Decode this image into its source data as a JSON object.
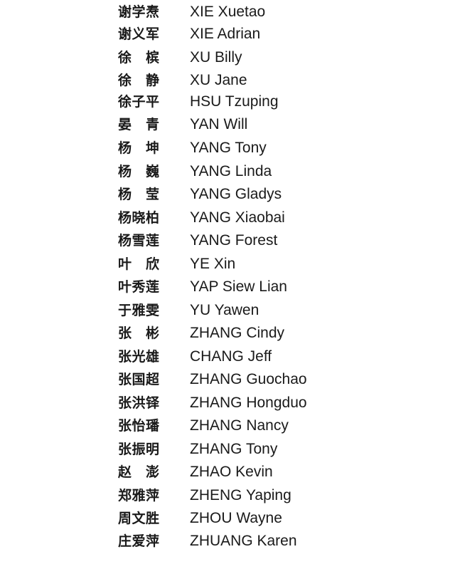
{
  "names": [
    {
      "chinese": "谢学焘",
      "english": "XIE Xuetao"
    },
    {
      "chinese": "谢义军",
      "english": "XIE Adrian"
    },
    {
      "chinese": "徐　槟",
      "english": "XU Billy"
    },
    {
      "chinese": "徐　静",
      "english": "XU Jane"
    },
    {
      "chinese": "徐子平",
      "english": "HSU Tzuping"
    },
    {
      "chinese": "晏　青",
      "english": "YAN Will"
    },
    {
      "chinese": "杨　坤",
      "english": "YANG Tony"
    },
    {
      "chinese": "杨　巍",
      "english": "YANG Linda"
    },
    {
      "chinese": "杨　莹",
      "english": "YANG Gladys"
    },
    {
      "chinese": "杨晓柏",
      "english": "YANG Xiaobai"
    },
    {
      "chinese": "杨雪莲",
      "english": "YANG Forest"
    },
    {
      "chinese": "叶　欣",
      "english": "YE Xin"
    },
    {
      "chinese": "叶秀莲",
      "english": "YAP Siew Lian"
    },
    {
      "chinese": "于雅雯",
      "english": "YU Yawen"
    },
    {
      "chinese": "张　彬",
      "english": "ZHANG Cindy"
    },
    {
      "chinese": "张光雄",
      "english": "CHANG Jeff"
    },
    {
      "chinese": "张国超",
      "english": "ZHANG Guochao"
    },
    {
      "chinese": "张洪铎",
      "english": "ZHANG Hongduo"
    },
    {
      "chinese": "张怡璠",
      "english": "ZHANG Nancy"
    },
    {
      "chinese": "张振明",
      "english": "ZHANG Tony"
    },
    {
      "chinese": "赵　澎",
      "english": "ZHAO Kevin"
    },
    {
      "chinese": "郑雅萍",
      "english": "ZHENG Yaping"
    },
    {
      "chinese": "周文胜",
      "english": "ZHOU Wayne"
    },
    {
      "chinese": "庄爱萍",
      "english": "ZHUANG Karen"
    }
  ]
}
